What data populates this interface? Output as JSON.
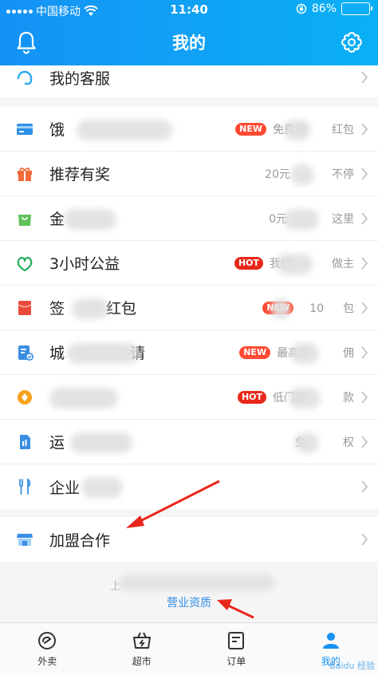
{
  "status": {
    "carrier": "中国移动",
    "time": "11:40",
    "battery": "86%",
    "battery_level": 0.86
  },
  "header": {
    "title": "我的"
  },
  "top_item": {
    "label": "我的客服"
  },
  "menu": [
    {
      "label": "饿",
      "badge": "NEW",
      "desc": "免费领",
      "desc2": "红包",
      "icon": "card-icon",
      "color": "#2e8fe6"
    },
    {
      "label": "推荐有奖",
      "badge": "",
      "desc": "20元",
      "desc2": "不停",
      "icon": "gift-icon",
      "color": "#f26b3a"
    },
    {
      "label": "金",
      "badge": "",
      "desc": "0元",
      "desc2": "这里",
      "icon": "bag-icon",
      "color": "#5fc15c"
    },
    {
      "label": "3小时公益",
      "badge": "HOT",
      "desc": "我的",
      "desc2": "做主",
      "icon": "heart-leaf-icon",
      "color": "#25b05a"
    },
    {
      "label": "签",
      "badge": "NEW",
      "desc": "10",
      "desc2": "包",
      "icon": "red-packet-icon",
      "color": "#ea4a3a"
    },
    {
      "label": "城",
      "badge": "NEW",
      "desc": "最高6",
      "desc2": "佣",
      "icon": "document-icon",
      "color": "#3a8de2"
    },
    {
      "label": "",
      "badge": "HOT",
      "desc": "低门槛",
      "desc2": "款",
      "icon": "coin-icon",
      "color": "#f7a21c"
    },
    {
      "label": "运",
      "badge": "",
      "desc": "免",
      "desc2": "权",
      "icon": "sim-icon",
      "color": "#3a8de2"
    },
    {
      "label": "企业",
      "badge": "",
      "desc": "",
      "desc2": "",
      "icon": "fork-knife-icon",
      "color": "#3a8de2"
    }
  ],
  "join": {
    "label": "加盟合作"
  },
  "footer": {
    "blurred_prefix": "上",
    "link": "营业资质"
  },
  "tabs": [
    {
      "label": "外卖",
      "icon": "takeout-icon"
    },
    {
      "label": "超市",
      "icon": "basket-icon"
    },
    {
      "label": "订单",
      "icon": "order-icon"
    },
    {
      "label": "我的",
      "icon": "profile-icon"
    }
  ],
  "watermark": "Baidu 经验",
  "colors": {
    "header_start": "#1592f5",
    "header_end": "#0ab0f5",
    "accent": "#2f8de6",
    "new_badge": "#ff4b33",
    "hot_badge": "#e8281b",
    "arrow": "#e8281b"
  }
}
